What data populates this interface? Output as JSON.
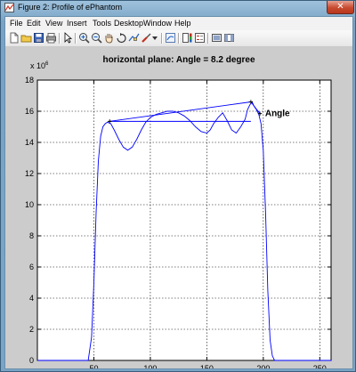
{
  "window": {
    "title": "Figure 2: Profile of ePhantom",
    "close_label": "✕"
  },
  "menu": [
    "File",
    "Edit",
    "View",
    "Insert",
    "Tools",
    "Desktop",
    "Window",
    "Help"
  ],
  "toolbar": {
    "icons": [
      "new-figure-icon",
      "open-file-icon",
      "save-icon",
      "print-icon",
      "edit-plot-pointer-icon",
      "zoom-in-icon",
      "zoom-out-icon",
      "pan-hand-icon",
      "rotate-3d-icon",
      "data-cursor-icon",
      "brush-icon",
      "link-plot-icon",
      "insert-colorbar-icon",
      "insert-legend-icon",
      "hide-plot-tools-icon",
      "show-plot-tools-icon"
    ]
  },
  "colors": {
    "line": "#0000ff",
    "axes_bg": "#ffffff",
    "figure_bg": "#cccccc",
    "window_frame": "#78a3c4"
  },
  "chart_data": {
    "type": "line",
    "title": "horizontal plane: Angle = 8.2 degree",
    "exponent_base": "x 10",
    "exponent_power": "6",
    "xlim": [
      0,
      260
    ],
    "ylim": [
      0,
      18
    ],
    "xticks": [
      50,
      100,
      150,
      200,
      250
    ],
    "yticks": [
      0,
      2,
      4,
      6,
      8,
      10,
      12,
      14,
      16,
      18
    ],
    "grid": true,
    "x_unit_scale": "pixel",
    "y_scale_note": "values in units of 1e6",
    "series": [
      {
        "values_x": [
          0,
          45,
          48,
          50,
          52,
          54,
          56,
          58,
          60,
          62,
          65,
          68,
          72,
          76,
          80,
          84,
          88,
          92,
          96,
          100,
          105,
          110,
          115,
          120,
          125,
          130,
          135,
          140,
          145,
          150,
          153,
          156,
          160,
          164,
          168,
          172,
          176,
          180,
          184,
          186,
          188,
          190,
          192,
          194,
          196,
          198,
          200,
          202,
          204,
          206,
          208,
          210,
          215,
          260
        ],
        "values_y": [
          0,
          0,
          1.5,
          5,
          9.5,
          12.8,
          14.4,
          15.0,
          15.2,
          15.3,
          15.2,
          14.8,
          14.2,
          13.7,
          13.5,
          13.7,
          14.2,
          14.8,
          15.3,
          15.6,
          15.8,
          15.9,
          16.0,
          16.0,
          15.9,
          15.7,
          15.4,
          15.0,
          14.7,
          14.6,
          14.8,
          15.2,
          15.6,
          15.9,
          15.4,
          14.8,
          14.6,
          15.0,
          15.5,
          16.1,
          16.4,
          16.6,
          16.3,
          16.1,
          15.8,
          15.2,
          13.5,
          9.5,
          4.5,
          1.3,
          0.3,
          0,
          0,
          0
        ]
      }
    ],
    "annotation": {
      "label": "Angle",
      "marker_points": [
        [
          64,
          15.35
        ],
        [
          189,
          16.6
        ],
        [
          197,
          15.85
        ]
      ],
      "segments": [
        [
          [
            64,
            15.35
          ],
          [
            189,
            16.6
          ]
        ],
        [
          [
            64,
            15.35
          ],
          [
            189,
            15.35
          ]
        ],
        [
          [
            189,
            16.6
          ],
          [
            197,
            15.85
          ]
        ]
      ],
      "label_at": [
        200,
        15.85
      ]
    }
  }
}
